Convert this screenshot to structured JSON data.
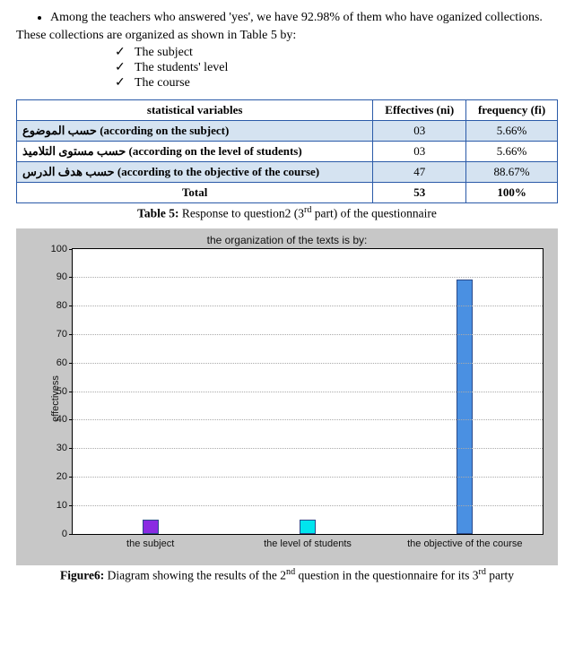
{
  "bullet_text": "Among the teachers who answered 'yes', we have 92.98% of them who have oganized collections.",
  "intro_line": "These collections are organized as shown in Table 5 by:",
  "check_items": [
    "The subject",
    "The students' level",
    "The course"
  ],
  "table": {
    "headers": [
      "statistical variables",
      "Effectives (ni)",
      "frequency (fi)"
    ],
    "rows": [
      {
        "label": "حسب الموضوع (according on the subject)",
        "ni": "03",
        "fi": "5.66%",
        "shaded": true
      },
      {
        "label": "حسب مستوى التلاميذ (according on the level of students)",
        "ni": "03",
        "fi": "5.66%",
        "shaded": false
      },
      {
        "label": "حسب هدف الدرس (according to the objective of the course)",
        "ni": "47",
        "fi": "88.67%",
        "shaded": true
      }
    ],
    "total": {
      "label": "Total",
      "ni": "53",
      "fi": "100%"
    }
  },
  "table_caption_bold": "Table 5:",
  "table_caption_rest_a": " Response to question2 (3",
  "table_caption_sup": "rd",
  "table_caption_rest_b": " part) of the questionnaire",
  "chart_data": {
    "type": "bar",
    "title": "the organization of the texts is by:",
    "ylabel": "effectivess",
    "xlabel": "",
    "ylim": [
      0,
      100
    ],
    "yticks": [
      0,
      10,
      20,
      30,
      40,
      50,
      60,
      70,
      80,
      90,
      100
    ],
    "categories": [
      "the subject",
      "the level of students",
      "the objective of the course"
    ],
    "values": [
      5,
      5,
      89
    ],
    "colors": [
      "#8a2be2",
      "#00e5ee",
      "#4a90e2"
    ]
  },
  "figure_caption_bold": "Figure6:",
  "figure_caption_a": " Diagram showing the results of the 2",
  "figure_caption_sup1": "nd",
  "figure_caption_b": " question in the questionnaire for its 3",
  "figure_caption_sup2": "rd",
  "figure_caption_c": " party"
}
